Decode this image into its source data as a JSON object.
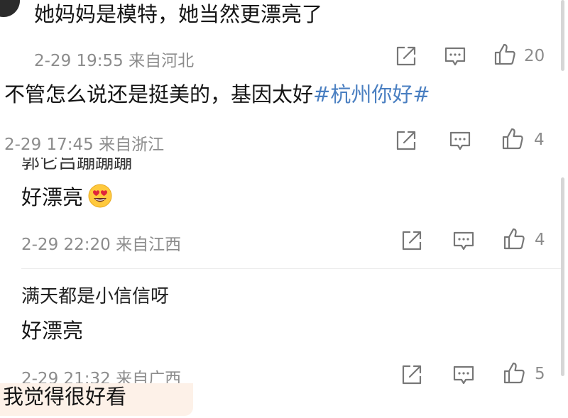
{
  "comments": [
    {
      "text": "她妈妈是模特，她当然更漂亮了",
      "time": "2-29 19:55",
      "location": "来自河北",
      "likes": "20"
    },
    {
      "text": "不管怎么说还是挺美的，基因太好",
      "hashtag": "#杭州你好#",
      "time": "2-29 17:45",
      "location": "来自浙江",
      "likes": "4"
    },
    {
      "author_partial": "郭它吕蹦蹦蹦",
      "text": "好漂亮",
      "emoji": "heart-eyes-emoji",
      "time": "2-29 22:20",
      "location": "来自江西",
      "likes": "4"
    },
    {
      "author": "满天都是小信信呀",
      "text": "好漂亮",
      "time": "2-29 21:32",
      "location": "来自广西",
      "likes": "5"
    },
    {
      "text": "我觉得很好看"
    }
  ],
  "icons": [
    "avatar",
    "share-icon",
    "comment-icon",
    "like-icon",
    "heart-eyes-emoji"
  ],
  "colors": {
    "hashtag": "#4a7fc1",
    "meta": "#8c8c8c",
    "text": "#141414",
    "highlight": "#fdf1e8"
  }
}
